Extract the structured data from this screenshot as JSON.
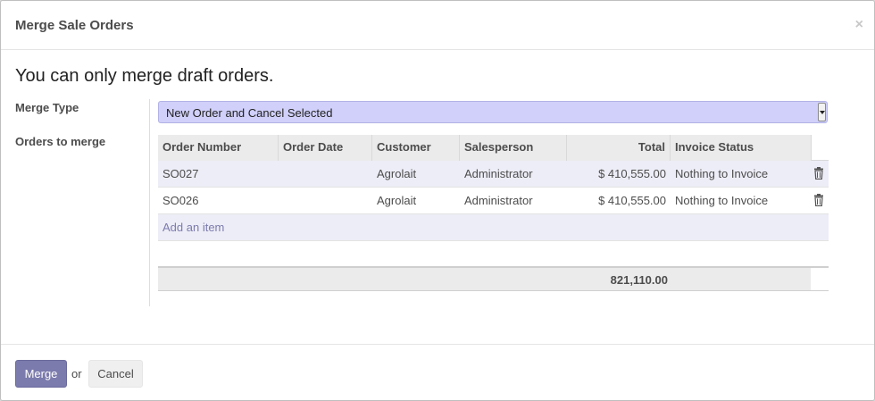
{
  "dialog": {
    "title": "Merge Sale Orders",
    "close_symbol": "×"
  },
  "notice": "You can only merge draft orders.",
  "form": {
    "merge_type_label": "Merge Type",
    "merge_type_value": "New Order and Cancel Selected",
    "orders_label": "Orders to merge"
  },
  "table": {
    "columns": [
      "Order Number",
      "Order Date",
      "Customer",
      "Salesperson",
      "Total",
      "Invoice Status"
    ],
    "rows": [
      {
        "order_number": "SO027",
        "order_date": "",
        "customer": "Agrolait",
        "salesperson": "Administrator",
        "total": "$ 410,555.00",
        "invoice_status": "Nothing to Invoice"
      },
      {
        "order_number": "SO026",
        "order_date": "",
        "customer": "Agrolait",
        "salesperson": "Administrator",
        "total": "$ 410,555.00",
        "invoice_status": "Nothing to Invoice"
      }
    ],
    "add_item_label": "Add an item",
    "sum_total": "821,110.00"
  },
  "footer": {
    "merge_label": "Merge",
    "or_text": "or",
    "cancel_label": "Cancel"
  },
  "colors": {
    "accent": "#7c7bad",
    "select_bg": "#d0d0fa",
    "row_stripe": "#ededf7"
  },
  "icons": {
    "close": "close-icon",
    "delete": "trash-icon",
    "dropdown": "chevron-down-icon"
  }
}
